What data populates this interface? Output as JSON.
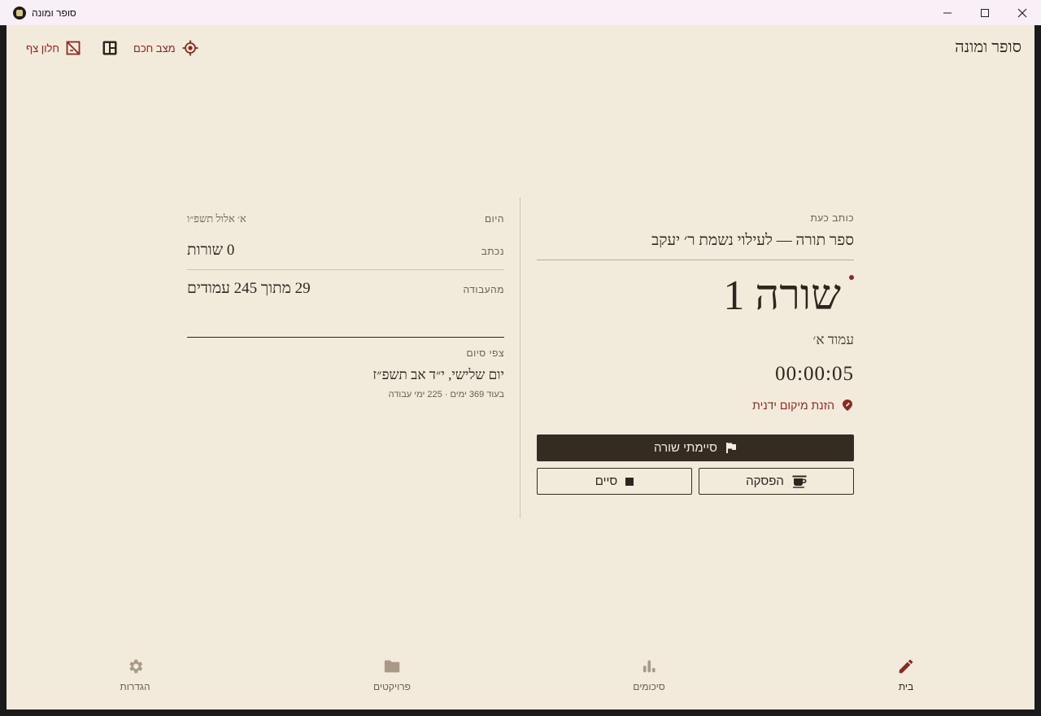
{
  "window": {
    "title": "סופר ומונה"
  },
  "header": {
    "brand": "סופר ומונה",
    "smart_mode_label": "מצב חכם",
    "float_window_label": "חלון צף"
  },
  "stats": {
    "today_label": "היום",
    "today_value": "א׳ אלול תשפ״ו",
    "written_label": "נכתב",
    "written_value": "0 שורות",
    "progress_label": "מהעבודה",
    "progress_value": "29 מתוך 245 עמודים",
    "finish_label": "צפי סיום",
    "finish_date": "יום שלישי, י״ד אב תשפ״ז",
    "finish_sub": "בעוד 369 ימים · 225 ימי עבודה"
  },
  "current": {
    "now_writing_label": "כותב כעת",
    "project_name": "ספר תורה — לעילוי נשמת ר׳ יעקב",
    "line_display": "שורה 1",
    "amud_display": "עמוד א׳",
    "timer": "00:00:05",
    "manual_location_label": "הזנת מיקום ידנית",
    "finish_line_label": "סיימתי שורה",
    "pause_label": "הפסקה",
    "stop_label": "סיים"
  },
  "nav": {
    "home": "בית",
    "summaries": "סיכומים",
    "projects": "פרויקטים",
    "settings": "הגדרות"
  },
  "colors": {
    "background": "#f2eadb",
    "accent": "#8a2a22",
    "primary_button": "#342b22",
    "text": "#2c2620"
  }
}
